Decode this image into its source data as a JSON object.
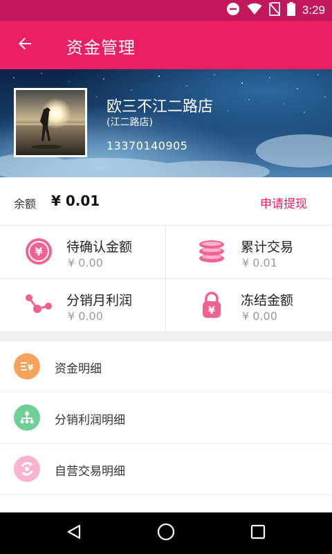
{
  "status_bar": {
    "time": "3:29",
    "icons": [
      "do-not-disturb-icon",
      "wifi-icon",
      "no-sim-icon",
      "battery-icon"
    ]
  },
  "app_bar": {
    "title": "资金管理",
    "back_icon": "arrow-back-icon"
  },
  "profile": {
    "shop_name": "欧三不江二路店",
    "sub_name": "(江二路店)",
    "phone": "13370140905"
  },
  "balance": {
    "label": "余额",
    "value": "¥ 0.01",
    "action": "申请提现"
  },
  "stats": [
    {
      "title": "待确认金额",
      "value": "¥ 0.00",
      "icon": "yen-coin-icon"
    },
    {
      "title": "累计交易",
      "value": "¥ 0.01",
      "icon": "coin-stack-icon"
    },
    {
      "title": "分销月利润",
      "value": "¥ 0.00",
      "icon": "share-nodes-icon"
    },
    {
      "title": "冻结金额",
      "value": "¥ 0.00",
      "icon": "locked-yen-icon"
    }
  ],
  "menu": [
    {
      "label": "资金明细",
      "icon": "fund-detail-icon"
    },
    {
      "label": "分销利润明细",
      "icon": "distribution-tree-icon"
    },
    {
      "label": "自营交易明细",
      "icon": "self-trade-icon"
    }
  ],
  "colors": {
    "status_bar": "#c2185b",
    "primary": "#e91e63",
    "accent_pink": "#f06292",
    "icon_orange": "#f5a25d",
    "icon_green": "#6fcf97",
    "icon_pink_light": "#f8a8c8",
    "muted_text": "#9a9a9a"
  }
}
